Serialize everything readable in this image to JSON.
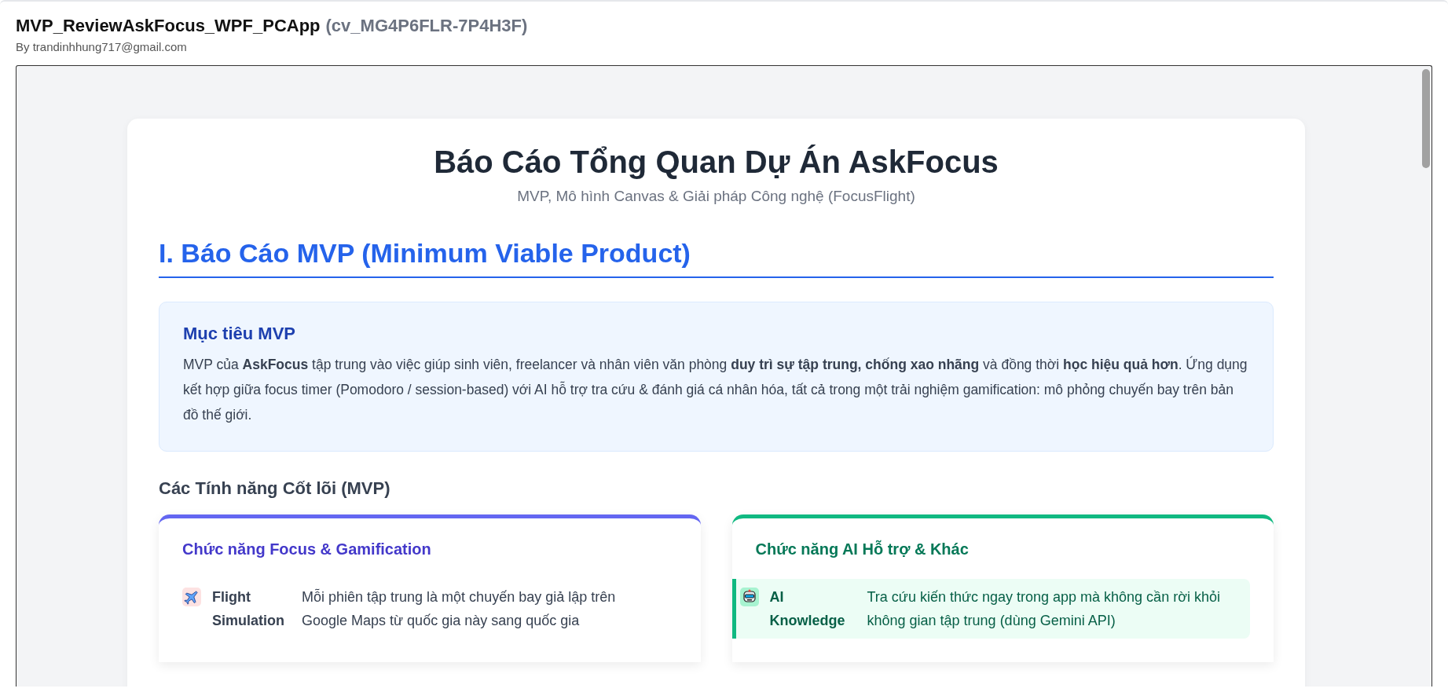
{
  "header": {
    "title": "MVP_ReviewAskFocus_WPF_PCApp",
    "code": "(cv_MG4P6FLR-7P4H3F)",
    "author": "By trandinhhung717@gmail.com"
  },
  "report": {
    "title": "Báo Cáo Tổng Quan Dự Án AskFocus",
    "subtitle": "MVP, Mô hình Canvas & Giải pháp Công nghệ (FocusFlight)",
    "section": {
      "heading": "I. Báo Cáo MVP (Minimum Viable Product)",
      "goal": {
        "heading": "Mục tiêu MVP",
        "text": "MVP của **AskFocus** tập trung vào việc giúp sinh viên, freelancer và nhân viên văn phòng **duy trì sự tập trung, chống xao nhãng** và đồng thời **học hiệu quả hơn**. Ứng dụng kết hợp giữa focus timer (Pomodoro / session-based) với AI hỗ trợ tra cứu & đánh giá cá nhân hóa, tất cả trong một trải nghiệm gamification: mô phỏng chuyến bay trên bản đồ thế giới."
      },
      "features_heading": "Các Tính năng Cốt lõi (MVP)",
      "cards": [
        {
          "kind": "focus",
          "heading": "Chức năng Focus & Gamification",
          "items": [
            {
              "kind": "plain",
              "label": "Flight Simulation",
              "text": "Mỗi phiên tập trung là một chuyến bay giả lập trên Google Maps từ quốc gia này sang quốc gia"
            }
          ]
        },
        {
          "kind": "ai",
          "heading": "Chức năng AI Hỗ trợ & Khác",
          "items": [
            {
              "kind": "highlighted",
              "label": "AI Knowledge",
              "text": "Tra cứu kiến thức ngay trong app mà không cần rời khỏi không gian tập trung (dùng Gemini API)"
            }
          ]
        }
      ]
    }
  }
}
